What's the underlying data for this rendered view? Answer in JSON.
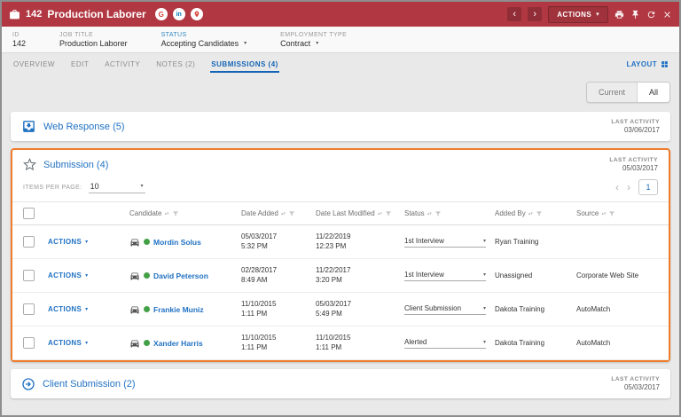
{
  "header": {
    "id": "142",
    "title": "Production Laborer",
    "actions_label": "ACTIONS",
    "google_glyph": "G",
    "linkedin_glyph": "in"
  },
  "record_fields": {
    "id_label": "ID",
    "id_value": "142",
    "job_title_label": "JOB TITLE",
    "job_title_value": "Production Laborer",
    "status_label": "STATUS",
    "status_value": "Accepting Candidates",
    "employment_type_label": "EMPLOYMENT TYPE",
    "employment_type_value": "Contract"
  },
  "tabs": {
    "overview": "OVERVIEW",
    "edit": "EDIT",
    "activity": "ACTIVITY",
    "notes": "NOTES (2)",
    "submissions": "SUBMISSIONS (4)",
    "layout_label": "LAYOUT"
  },
  "toggle": {
    "current": "Current",
    "all": "All"
  },
  "web_response": {
    "title": "Web Response (5)",
    "last_activity_label": "LAST ACTIVITY",
    "last_activity_date": "03/06/2017"
  },
  "submission": {
    "title": "Submission (4)",
    "last_activity_label": "LAST ACTIVITY",
    "last_activity_date": "05/03/2017",
    "items_per_page_label": "ITEMS PER PAGE:",
    "items_per_page_value": "10",
    "page_number": "1",
    "actions_label": "ACTIONS",
    "columns": {
      "candidate": "Candidate",
      "date_added": "Date Added",
      "date_last_modified": "Date Last Modified",
      "status": "Status",
      "added_by": "Added By",
      "source": "Source"
    },
    "rows": [
      {
        "candidate": "Mordin Solus",
        "date_added": "05/03/2017",
        "date_added_time": "5:32 PM",
        "date_modified": "11/22/2019",
        "date_modified_time": "12:23 PM",
        "status": "1st Interview",
        "added_by": "Ryan Training",
        "source": ""
      },
      {
        "candidate": "David Peterson",
        "date_added": "02/28/2017",
        "date_added_time": "8:49 AM",
        "date_modified": "11/22/2017",
        "date_modified_time": "3:20 PM",
        "status": "1st Interview",
        "added_by": "Unassigned",
        "source": "Corporate Web Site"
      },
      {
        "candidate": "Frankie Muniz",
        "date_added": "11/10/2015",
        "date_added_time": "1:11 PM",
        "date_modified": "05/03/2017",
        "date_modified_time": "5:49 PM",
        "status": "Client Submission",
        "added_by": "Dakota Training",
        "source": "AutoMatch"
      },
      {
        "candidate": "Xander Harris",
        "date_added": "11/10/2015",
        "date_added_time": "1:11 PM",
        "date_modified": "11/10/2015",
        "date_modified_time": "1:11 PM",
        "status": "Alerted",
        "added_by": "Dakota Training",
        "source": "AutoMatch"
      }
    ]
  },
  "client_submission": {
    "title": "Client Submission (2)",
    "last_activity_label": "LAST ACTIVITY",
    "last_activity_date": "05/03/2017"
  },
  "colors": {
    "header_red": "#B13842",
    "accent_blue": "#2272C3",
    "highlight_orange": "#EE7C2B",
    "status_green": "#43A047"
  }
}
